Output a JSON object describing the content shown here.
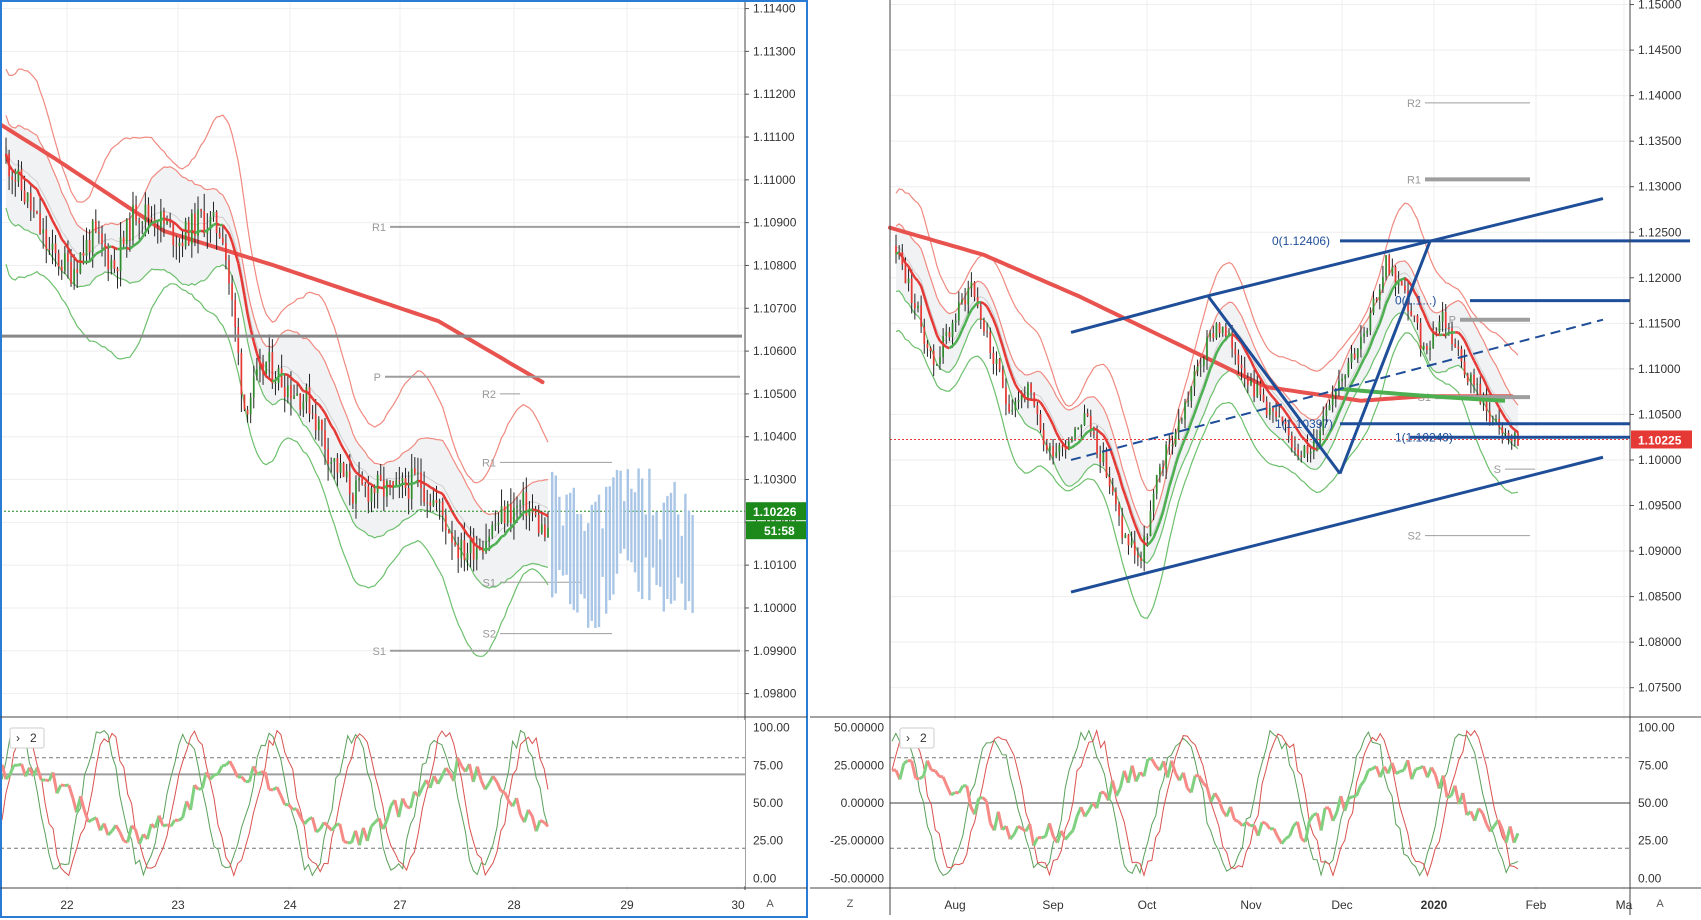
{
  "colors": {
    "up": "#2e8b2e",
    "down": "#e53935",
    "ma_red": "#e8534f",
    "band_red": "#f08a80",
    "band_green": "#6dc06d",
    "trend_blue": "#1f4e99",
    "pivot_grey": "#9e9e9e",
    "price_badge_green": "#1b8a1b",
    "price_badge_red": "#e53935",
    "panel_border": "#2a7bd4"
  },
  "left_chart": {
    "price_label": "1.10226",
    "countdown_label": "51:58",
    "axis_corner": "A",
    "pivots": [
      {
        "label": "R1",
        "value": 1.1089
      },
      {
        "label": "P",
        "value": 1.1054
      },
      {
        "label": "R2",
        "value": 1.105
      },
      {
        "label": "R1",
        "value": 1.1034
      },
      {
        "label": "S1",
        "value": 1.1006
      },
      {
        "label": "S2",
        "value": 1.0994
      },
      {
        "label": "S1",
        "value": 1.099
      }
    ]
  },
  "right_chart": {
    "price_label": "1.10225",
    "axis_corner_left": "Z",
    "axis_corner_right": "A",
    "fib_labels": [
      "0(1.12406)",
      "0(1.1...)",
      "1(1.10397)",
      "1(1.10249)"
    ],
    "pivots": [
      {
        "label": "R2",
        "value": 1.1392
      },
      {
        "label": "R1",
        "value": 1.1308
      },
      {
        "label": "P",
        "value": 1.1154
      },
      {
        "label": "S1",
        "value": 1.1069
      },
      {
        "label": "P",
        "value": 1.1054
      },
      {
        "label": "S",
        "value": 1.099
      },
      {
        "label": "S2",
        "value": 1.0917
      }
    ]
  },
  "left_osc": {
    "toggle_label": "2"
  },
  "right_osc": {
    "toggle_label": "2"
  },
  "chart_data": [
    {
      "type": "candlestick",
      "title": "",
      "x_ticks": [
        "22",
        "23",
        "24",
        "27",
        "28",
        "29",
        "30"
      ],
      "y_ticks": [
        "1.11400",
        "1.11300",
        "1.11200",
        "1.11100",
        "1.11000",
        "1.10900",
        "1.10800",
        "1.10700",
        "1.10600",
        "1.10500",
        "1.10400",
        "1.10300",
        "1.10200",
        "1.10100",
        "1.10000",
        "1.09900",
        "1.09800"
      ],
      "ylim": [
        1.0975,
        1.1142
      ],
      "last_price": 1.10226,
      "moving_average": [
        [
          0,
          1.1113
        ],
        [
          0.1,
          1.1105
        ],
        [
          0.3,
          1.1088
        ],
        [
          0.5,
          1.108
        ],
        [
          0.8,
          1.1067
        ],
        [
          1.0,
          1.1052
        ]
      ],
      "series": [
        {
          "name": "close",
          "values": [
            1.1105,
            1.1095,
            1.1083,
            1.1079,
            1.1087,
            1.108,
            1.1093,
            1.1091,
            1.1086,
            1.1091,
            1.1088,
            1.1047,
            1.1057,
            1.1052,
            1.1048,
            1.1035,
            1.1027,
            1.1028,
            1.1027,
            1.103,
            1.1023,
            1.1013,
            1.1016,
            1.1022,
            1.1024,
            1.1016
          ]
        }
      ]
    },
    {
      "type": "candlestick",
      "title": "",
      "x_ticks": [
        "Aug",
        "Sep",
        "Oct",
        "Nov",
        "Dec",
        "2020",
        "Feb",
        "Ma"
      ],
      "y_ticks": [
        "1.15000",
        "1.14500",
        "1.14000",
        "1.13500",
        "1.13000",
        "1.12500",
        "1.12000",
        "1.11500",
        "1.11000",
        "1.10500",
        "1.10000",
        "1.09500",
        "1.09000",
        "1.08500",
        "1.08000",
        "1.07500"
      ],
      "ylim": [
        1.072,
        1.1505
      ],
      "last_price": 1.10225,
      "moving_average": [
        [
          0,
          1.1255
        ],
        [
          0.15,
          1.1225
        ],
        [
          0.3,
          1.118
        ],
        [
          0.45,
          1.113
        ],
        [
          0.6,
          1.108
        ],
        [
          0.75,
          1.1065
        ],
        [
          0.85,
          1.107
        ]
      ],
      "series": [
        {
          "name": "close",
          "values": [
            1.1235,
            1.117,
            1.1105,
            1.115,
            1.1195,
            1.112,
            1.106,
            1.1075,
            1.101,
            1.102,
            1.105,
            1.1,
            1.092,
            1.089,
            1.099,
            1.104,
            1.11,
            1.115,
            1.112,
            1.108,
            1.105,
            1.102,
            1.1005,
            1.107,
            1.111,
            1.114,
            1.122,
            1.118,
            1.112,
            1.116,
            1.111,
            1.107,
            1.103,
            1.102
          ]
        }
      ]
    },
    {
      "type": "line",
      "title": "",
      "y_ticks": [
        "100.00",
        "75.00",
        "50.00",
        "25.00",
        "0.00"
      ],
      "ylim": [
        -5,
        105
      ]
    },
    {
      "type": "line",
      "title": "",
      "y_ticks": [
        "100.00",
        "75.00",
        "50.00",
        "25.00",
        "0.00"
      ],
      "y_ticks_left": [
        "50.00000",
        "25.00000",
        "0.00000",
        "-25.00000",
        "-50.00000"
      ],
      "ylim": [
        -5,
        105
      ]
    }
  ]
}
